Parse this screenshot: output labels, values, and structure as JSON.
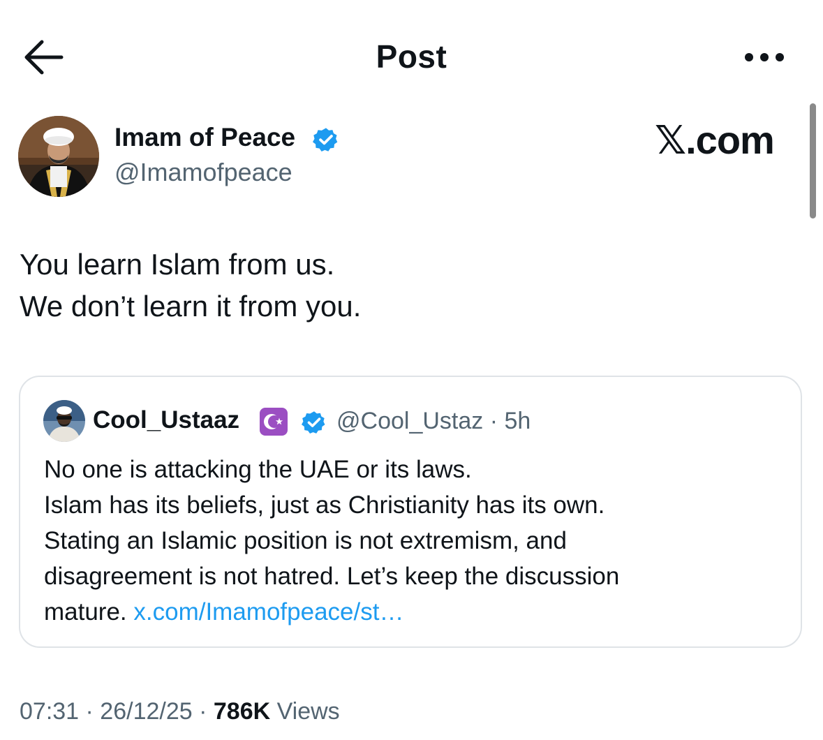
{
  "header": {
    "title": "Post",
    "back_icon": "arrow-left-icon",
    "more_icon": "ellipsis-icon"
  },
  "post": {
    "author_name": "Imam of Peace",
    "author_handle": "@Imamofpeace",
    "verified_icon": "verified-badge-icon",
    "watermark": "𝕏.com",
    "lines": [
      "You learn Islam from us.",
      "We don’t learn it from you."
    ],
    "timestamp": "07:31 · 26/12/25 · ",
    "views_count": "786K",
    "views_label": " Views"
  },
  "quote": {
    "author_name": "Cool_Ustaaz",
    "emoji_icon": "star-and-crescent-icon",
    "verified_icon": "verified-badge-icon",
    "handle_time": "@Cool_Ustaz · 5h",
    "lines": [
      "No one is attacking the UAE or its laws.",
      "Islam has its beliefs, just as Christianity has its own.",
      "Stating an Islamic position is not extremism, and",
      "disagreement is not hatred. Let’s keep the discussion",
      "mature. "
    ],
    "link_text": "x.com/Imamofpeace/st…"
  },
  "colors": {
    "text_primary": "#0f1419",
    "text_secondary": "#536471",
    "link": "#1d9bf0",
    "verified": "#1d9bf0",
    "emoji_bg": "#9b4ec2",
    "border": "#dfe3e7"
  }
}
